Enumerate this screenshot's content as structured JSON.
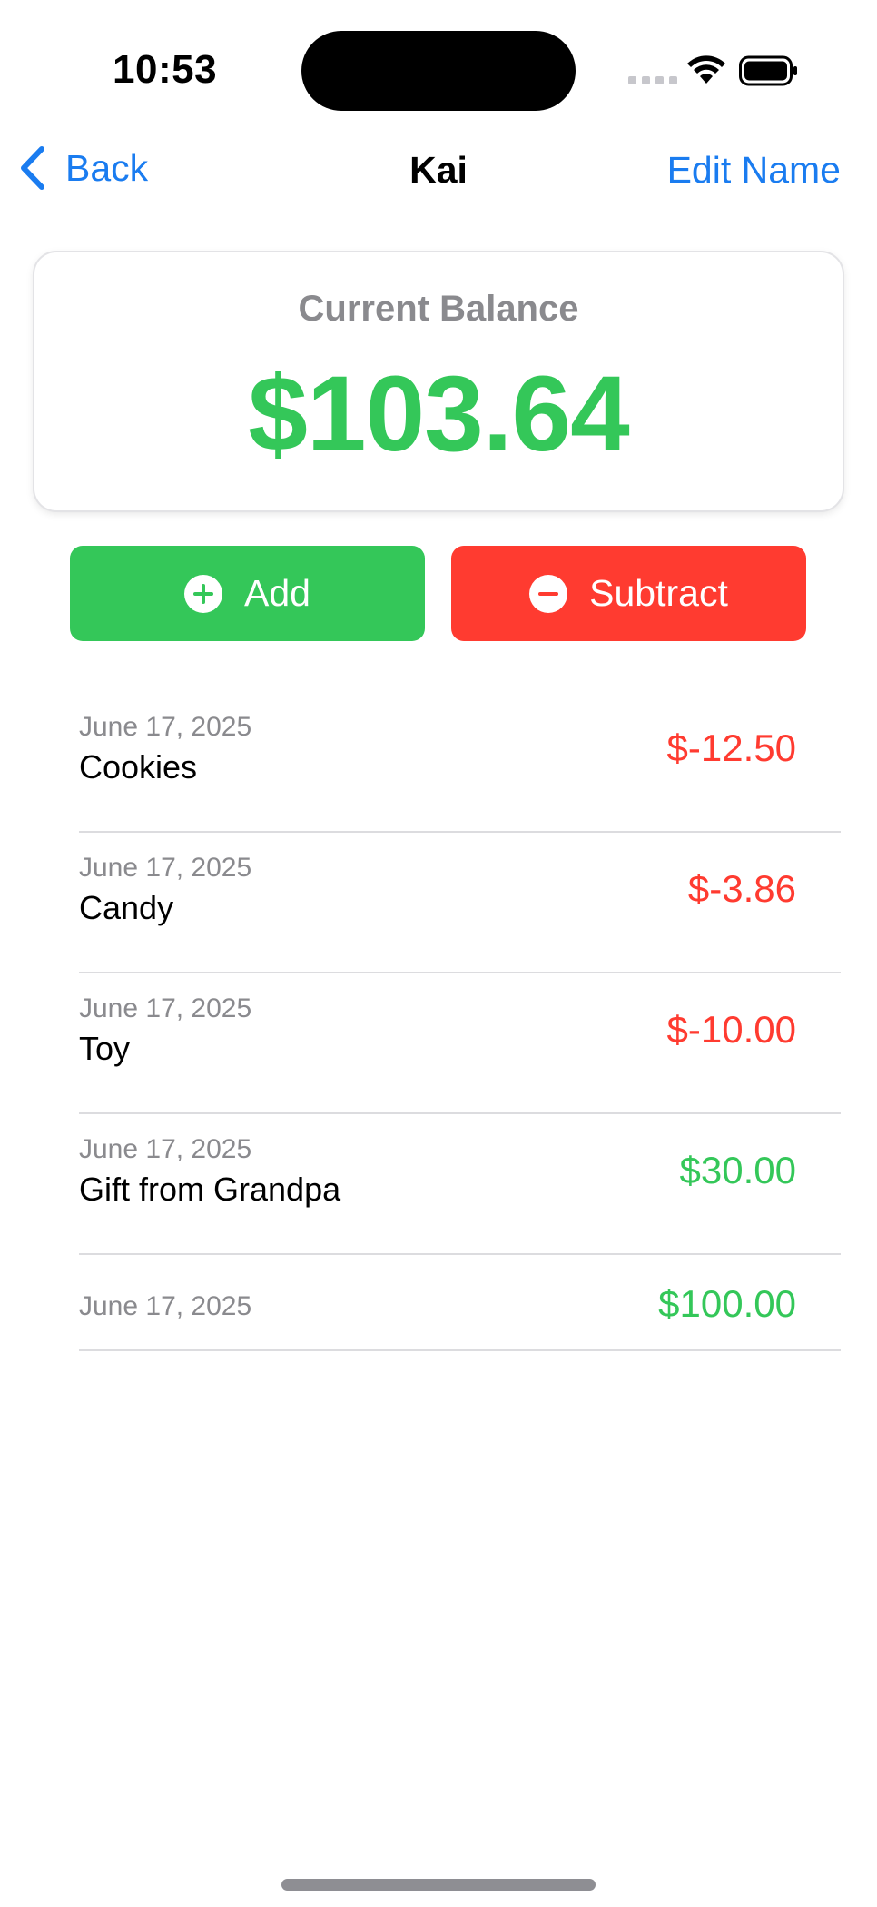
{
  "status_bar": {
    "time": "10:53"
  },
  "nav": {
    "back_label": "Back",
    "title": "Kai",
    "edit_label": "Edit Name"
  },
  "balance": {
    "label": "Current Balance",
    "amount": "$103.64"
  },
  "actions": {
    "add_label": "Add",
    "subtract_label": "Subtract"
  },
  "transactions": [
    {
      "date": "June 17, 2025",
      "description": "Cookies",
      "amount": "$-12.50",
      "type": "debit"
    },
    {
      "date": "June 17, 2025",
      "description": "Candy",
      "amount": "$-3.86",
      "type": "debit"
    },
    {
      "date": "June 17, 2025",
      "description": "Toy",
      "amount": "$-10.00",
      "type": "debit"
    },
    {
      "date": "June 17, 2025",
      "description": "Gift from Grandpa",
      "amount": "$30.00",
      "type": "credit"
    },
    {
      "date": "June 17, 2025",
      "description": "",
      "amount": "$100.00",
      "type": "credit"
    }
  ],
  "colors": {
    "accent_blue": "#1a7cf0",
    "positive_green": "#34c759",
    "negative_red": "#ff3b30"
  },
  "icons": {
    "back": "chevron-left-icon",
    "add": "plus-circle-icon",
    "subtract": "minus-circle-icon",
    "wifi": "wifi-icon",
    "battery": "battery-icon"
  }
}
